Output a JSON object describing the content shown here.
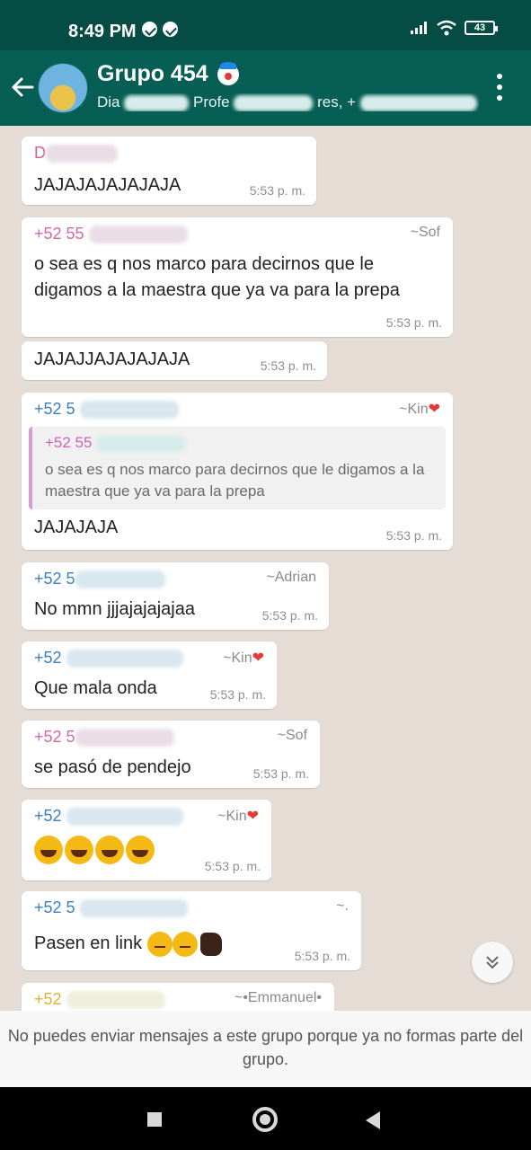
{
  "status_bar": {
    "time": "8:49 PM",
    "battery": "43"
  },
  "header": {
    "title": "Grupo 454",
    "subtitle_parts": [
      "Dia",
      "Profe",
      "res, +",
      "."
    ]
  },
  "messages": [
    {
      "sender": "D",
      "alias": "",
      "text": "JAJAJAJAJAJAJA",
      "time": "5:53 p. m.",
      "sender_color": "#d45f96"
    },
    {
      "sender": "+52 55",
      "alias": "~Sof",
      "text": "o sea es q nos marco para decirnos que le digamos a la maestra que ya va para la prepa",
      "time": "5:53 p. m.",
      "sender_color": "#d06aa8"
    },
    {
      "sender": "",
      "alias": "",
      "text": "JAJAJJAJAJAJAJA",
      "time": "5:53 p. m.",
      "sender_color": "#000000"
    },
    {
      "sender": "+52 5",
      "alias": "~Kin",
      "text": "JAJAJAJA",
      "time": "5:53 p. m.",
      "sender_color": "#3a7fc0",
      "quote": {
        "sender": "+52 55",
        "text": "o sea es q nos marco para decirnos que le digamos a la maestra que ya va para la prepa"
      }
    },
    {
      "sender": "+52 5",
      "alias": "~Adrian",
      "text": "No mmn jjjajajajajaa",
      "time": "5:53 p. m.",
      "sender_color": "#3a7fc0"
    },
    {
      "sender": "+52",
      "alias": "~Kin",
      "text": "Que mala onda",
      "time": "5:53 p. m.",
      "sender_color": "#3a7fc0"
    },
    {
      "sender": "+52 5",
      "alias": "~Sof",
      "text": "se pasó de pendejo",
      "time": "5:53 p. m.",
      "sender_color": "#d06aa8"
    },
    {
      "sender": "+52",
      "alias": "~Kin",
      "text": "",
      "time": "5:53 p. m.",
      "sender_color": "#3a7fc0",
      "emoji_count": 4
    },
    {
      "sender": "+52 5",
      "alias": "~.",
      "text": "Pasen en link",
      "time": "5:53 p. m.",
      "sender_color": "#3a7fc0"
    },
    {
      "sender": "+52",
      "alias": "~•Emmanuel•",
      "text": "",
      "time": "",
      "sender_color": "#e0b23a"
    }
  ],
  "footer": {
    "notice": "No puedes enviar mensajes a este grupo porque ya no formas parte del grupo."
  },
  "colors": {
    "header": "#075e54",
    "status_bar": "#054d44",
    "chat_bg": "#e5ddd5",
    "heart": "#e53935"
  },
  "icons": [
    "back-arrow-icon",
    "signal-icon",
    "wifi-icon",
    "battery-icon",
    "more-vertical-icon",
    "chevron-down-icon",
    "recent-apps-icon",
    "home-icon",
    "back-icon"
  ]
}
